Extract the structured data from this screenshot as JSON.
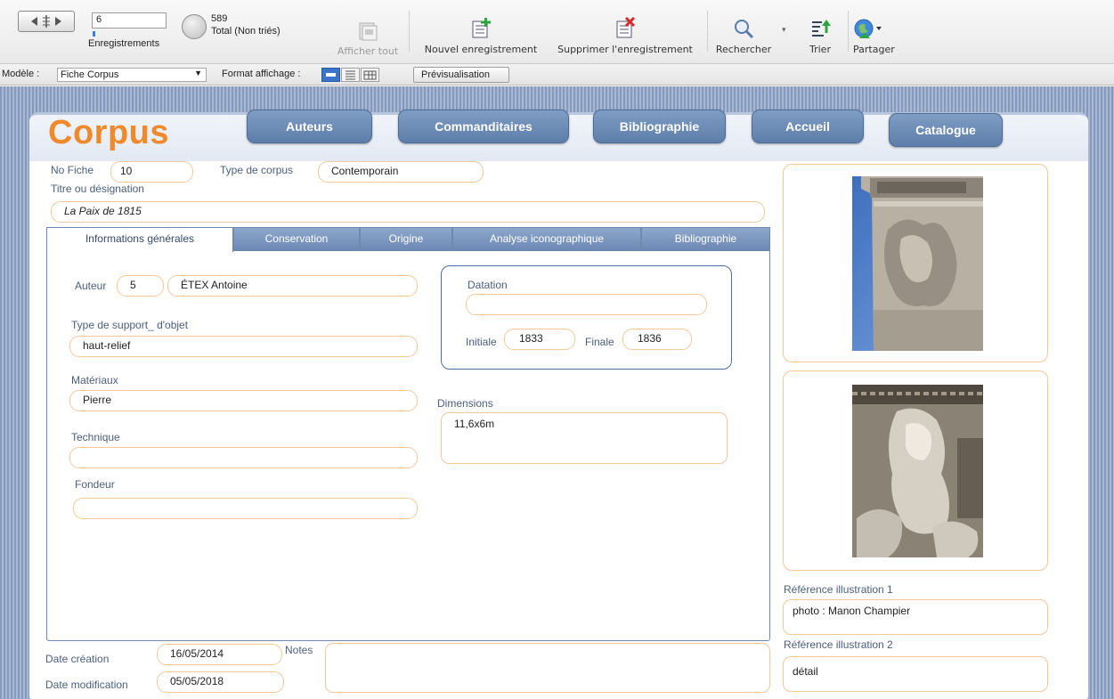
{
  "toolbar": {
    "record_current": "6",
    "records_label": "Enregistrements",
    "total_count": "589",
    "total_label": "Total (Non triés)",
    "show_all": "Afficher tout",
    "new_record": "Nouvel enregistrement",
    "delete_record": "Supprimer l'enregistrement",
    "search": "Rechercher",
    "sort": "Trier",
    "share": "Partager"
  },
  "modelbar": {
    "model_label": "Modèle :",
    "model_value": "Fiche Corpus",
    "format_label": "Format affichage :",
    "preview": "Prévisualisation"
  },
  "header": {
    "title": "Corpus",
    "nav": [
      "Auteurs",
      "Commanditaires",
      "Bibliographie",
      "Accueil",
      "Catalogue"
    ]
  },
  "record": {
    "no_fiche_label": "No Fiche",
    "no_fiche": "10",
    "type_corpus_label": "Type de corpus",
    "type_corpus": "Contemporain",
    "titre_label": "Titre ou désignation",
    "titre": "La Paix de 1815"
  },
  "tabs": [
    "Informations générales",
    "Conservation",
    "Origine",
    "Analyse iconographique",
    "Bibliographie"
  ],
  "general": {
    "auteur_label": "Auteur",
    "auteur_id": "5",
    "auteur_name": "ÉTEX Antoine",
    "support_label": "Type de support_ d'objet",
    "support": "haut-relief",
    "materiaux_label": "Matériaux",
    "materiaux": "Pierre",
    "technique_label": "Technique",
    "technique": "",
    "fondeur_label": "Fondeur",
    "fondeur": "",
    "datation_label": "Datation",
    "datation": "",
    "initiale_label": "Initiale",
    "initiale": "1833",
    "finale_label": "Finale",
    "finale": "1836",
    "dimensions_label": "Dimensions",
    "dimensions": "11,6x6m"
  },
  "footer": {
    "date_creation_label": "Date création",
    "date_creation": "16/05/2014",
    "date_modification_label": "Date modification",
    "date_modification": "05/05/2018",
    "notes_label": "Notes",
    "notes": ""
  },
  "illustrations": {
    "ref1_label": "Référence illustration 1",
    "ref1": "photo : Manon Champier",
    "ref2_label": "Référence illustration 2",
    "ref2": "détail"
  },
  "colors": {
    "title": "#ee8a2c",
    "nav_button": "#6f8fba",
    "field_border": "#f1c89a",
    "label": "#4b5e7c",
    "background_stripes": "#8499bb"
  }
}
